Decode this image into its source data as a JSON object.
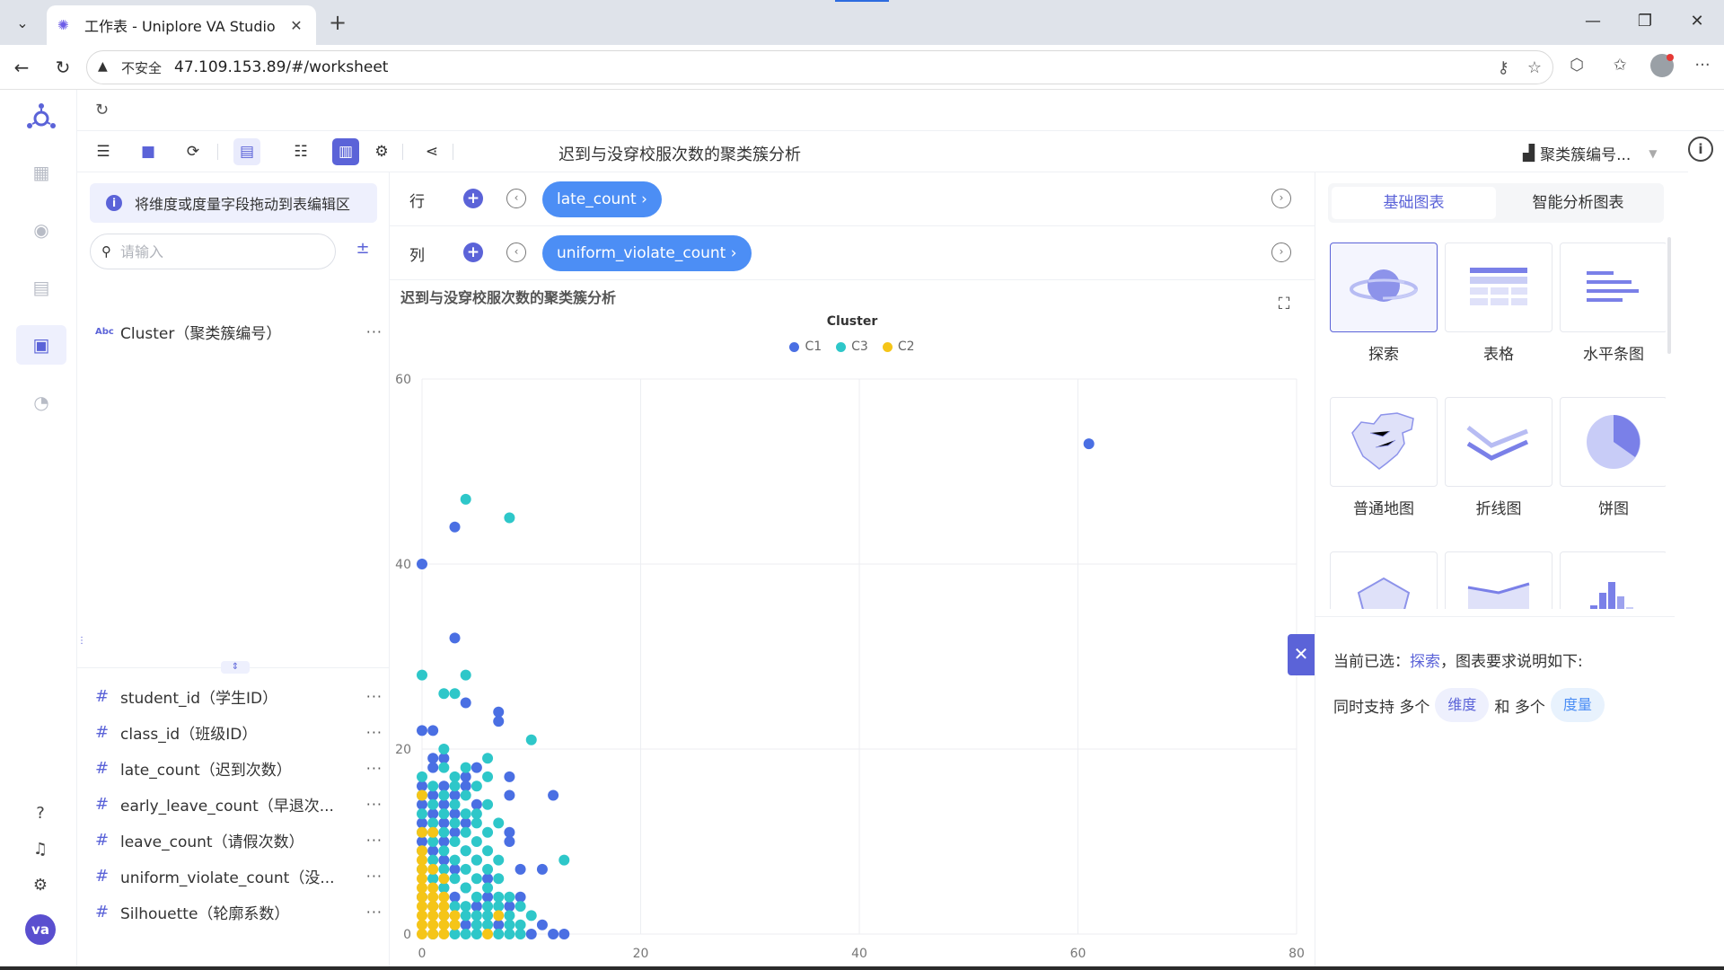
{
  "browser": {
    "tab_title": "工作表 - Uniplore VA Studio",
    "insecure_label": "不安全",
    "url": "47.109.153.89/#/worksheet"
  },
  "toolbar": {
    "worksheet_title": "迟到与没穿校服次数的聚类簇分析",
    "datasource_label": "聚类簇编号..."
  },
  "field_panel": {
    "hint": "将维度或度量字段拖动到表编辑区",
    "search_placeholder": "请输入",
    "dimensions": [
      {
        "type": "Abc",
        "name": "Cluster（聚类簇编号）"
      }
    ],
    "measures": [
      {
        "type": "#",
        "name": "student_id（学生ID）"
      },
      {
        "type": "#",
        "name": "class_id（班级ID）"
      },
      {
        "type": "#",
        "name": "late_count（迟到次数）"
      },
      {
        "type": "#",
        "name": "early_leave_count（早退次..."
      },
      {
        "type": "#",
        "name": "leave_count（请假次数）"
      },
      {
        "type": "#",
        "name": "uniform_violate_count（没..."
      },
      {
        "type": "#",
        "name": "Silhouette（轮廓系数）"
      }
    ],
    "more": "···"
  },
  "shelves": {
    "row_label": "行",
    "row_field": "late_count ›",
    "col_label": "列",
    "col_field": "uniform_violate_count ›"
  },
  "chart_panel": {
    "tabs": [
      "基础图表",
      "智能分析图表"
    ],
    "chart_types": [
      "探索",
      "表格",
      "水平条图",
      "普通地图",
      "折线图",
      "饼图"
    ],
    "desc_prefix": "当前已选：",
    "desc_selected": "探索",
    "desc_suffix": "，图表要求说明如下:",
    "req_prefix": "同时支持 多个",
    "req_dim": "维度",
    "req_mid": "和 多个",
    "req_measure": "度量"
  },
  "colors": {
    "accent": "#5b63d8",
    "pill": "#4c8ef5",
    "C1": "#4a6fe3",
    "C3": "#2ec7c9",
    "C2": "#f5c518"
  },
  "chart_data": {
    "type": "scatter",
    "title": "迟到与没穿校服次数的聚类簇分析",
    "legend_title": "Cluster",
    "legend_position": "top",
    "xlim": [
      0,
      80
    ],
    "ylim": [
      0,
      60
    ],
    "x_ticks": [
      "0",
      "20",
      "40",
      "60",
      "80"
    ],
    "y_ticks": [
      "0",
      "20",
      "40",
      "60"
    ],
    "grid": true,
    "series": [
      {
        "name": "C1",
        "color": "#4a6fe3",
        "points": [
          [
            61,
            53
          ],
          [
            0,
            40
          ],
          [
            3,
            44
          ],
          [
            3,
            32
          ],
          [
            4,
            25
          ],
          [
            7,
            24
          ],
          [
            7,
            23
          ],
          [
            0,
            22
          ],
          [
            1,
            22
          ],
          [
            12,
            15
          ],
          [
            8,
            15
          ],
          [
            1,
            19
          ],
          [
            2,
            19
          ],
          [
            1,
            18
          ],
          [
            5,
            18
          ],
          [
            4,
            17
          ],
          [
            8,
            17
          ],
          [
            0,
            16
          ],
          [
            2,
            16
          ],
          [
            4,
            16
          ],
          [
            1,
            15
          ],
          [
            3,
            15
          ],
          [
            0,
            14
          ],
          [
            2,
            14
          ],
          [
            5,
            14
          ],
          [
            1,
            13
          ],
          [
            3,
            13
          ],
          [
            0,
            12
          ],
          [
            2,
            12
          ],
          [
            4,
            12
          ],
          [
            8,
            11
          ],
          [
            1,
            11
          ],
          [
            3,
            11
          ],
          [
            0,
            10
          ],
          [
            2,
            10
          ],
          [
            4,
            9
          ],
          [
            8,
            10
          ],
          [
            5,
            8
          ],
          [
            2,
            8
          ],
          [
            1,
            9
          ],
          [
            11,
            7
          ],
          [
            9,
            7
          ],
          [
            3,
            7
          ],
          [
            1,
            6
          ],
          [
            6,
            6
          ],
          [
            2,
            5
          ],
          [
            4,
            5
          ],
          [
            0,
            4
          ],
          [
            3,
            4
          ],
          [
            6,
            4
          ],
          [
            9,
            4
          ],
          [
            1,
            3
          ],
          [
            5,
            3
          ],
          [
            8,
            3
          ],
          [
            11,
            1
          ],
          [
            12,
            0
          ],
          [
            13,
            0
          ],
          [
            10,
            0
          ],
          [
            7,
            1
          ],
          [
            4,
            1
          ],
          [
            2,
            2
          ]
        ]
      },
      {
        "name": "C3",
        "color": "#2ec7c9",
        "points": [
          [
            4,
            47
          ],
          [
            8,
            45
          ],
          [
            0,
            28
          ],
          [
            2,
            26
          ],
          [
            3,
            26
          ],
          [
            4,
            28
          ],
          [
            10,
            21
          ],
          [
            2,
            20
          ],
          [
            6,
            19
          ],
          [
            2,
            18
          ],
          [
            4,
            18
          ],
          [
            0,
            17
          ],
          [
            3,
            17
          ],
          [
            6,
            17
          ],
          [
            1,
            16
          ],
          [
            3,
            16
          ],
          [
            5,
            16
          ],
          [
            2,
            15
          ],
          [
            4,
            15
          ],
          [
            0,
            15
          ],
          [
            1,
            14
          ],
          [
            3,
            14
          ],
          [
            6,
            14
          ],
          [
            0,
            13
          ],
          [
            2,
            13
          ],
          [
            4,
            13
          ],
          [
            5,
            13
          ],
          [
            1,
            12
          ],
          [
            3,
            12
          ],
          [
            5,
            12
          ],
          [
            7,
            12
          ],
          [
            0,
            11
          ],
          [
            2,
            11
          ],
          [
            4,
            11
          ],
          [
            6,
            11
          ],
          [
            1,
            10
          ],
          [
            3,
            10
          ],
          [
            5,
            10
          ],
          [
            2,
            9
          ],
          [
            4,
            9
          ],
          [
            6,
            9
          ],
          [
            0,
            9
          ],
          [
            1,
            8
          ],
          [
            3,
            8
          ],
          [
            5,
            8
          ],
          [
            7,
            8
          ],
          [
            2,
            7
          ],
          [
            4,
            7
          ],
          [
            6,
            7
          ],
          [
            0,
            7
          ],
          [
            1,
            6
          ],
          [
            3,
            6
          ],
          [
            5,
            6
          ],
          [
            7,
            6
          ],
          [
            13,
            8
          ],
          [
            2,
            5
          ],
          [
            4,
            5
          ],
          [
            6,
            5
          ],
          [
            8,
            4
          ],
          [
            5,
            4
          ],
          [
            7,
            4
          ],
          [
            3,
            3
          ],
          [
            4,
            3
          ],
          [
            6,
            3
          ],
          [
            7,
            3
          ],
          [
            9,
            3
          ],
          [
            10,
            2
          ],
          [
            4,
            2
          ],
          [
            5,
            2
          ],
          [
            6,
            2
          ],
          [
            8,
            2
          ],
          [
            3,
            1
          ],
          [
            5,
            1
          ],
          [
            6,
            1
          ],
          [
            8,
            1
          ],
          [
            9,
            1
          ],
          [
            1,
            0
          ],
          [
            4,
            0
          ],
          [
            5,
            0
          ],
          [
            7,
            0
          ],
          [
            8,
            0
          ],
          [
            9,
            0
          ],
          [
            3,
            0
          ]
        ]
      },
      {
        "name": "C2",
        "color": "#f5c518",
        "points": [
          [
            0,
            15
          ],
          [
            0,
            11
          ],
          [
            1,
            11
          ],
          [
            0,
            9
          ],
          [
            0,
            8
          ],
          [
            0,
            7
          ],
          [
            1,
            7
          ],
          [
            0,
            6
          ],
          [
            2,
            6
          ],
          [
            0,
            5
          ],
          [
            1,
            5
          ],
          [
            0,
            4
          ],
          [
            1,
            4
          ],
          [
            2,
            4
          ],
          [
            0,
            3
          ],
          [
            1,
            3
          ],
          [
            2,
            3
          ],
          [
            0,
            2
          ],
          [
            1,
            2
          ],
          [
            2,
            2
          ],
          [
            3,
            2
          ],
          [
            0,
            1
          ],
          [
            1,
            1
          ],
          [
            2,
            1
          ],
          [
            0,
            0
          ],
          [
            1,
            0
          ],
          [
            2,
            0
          ],
          [
            3,
            1
          ],
          [
            6,
            0
          ],
          [
            7,
            2
          ]
        ]
      }
    ]
  }
}
